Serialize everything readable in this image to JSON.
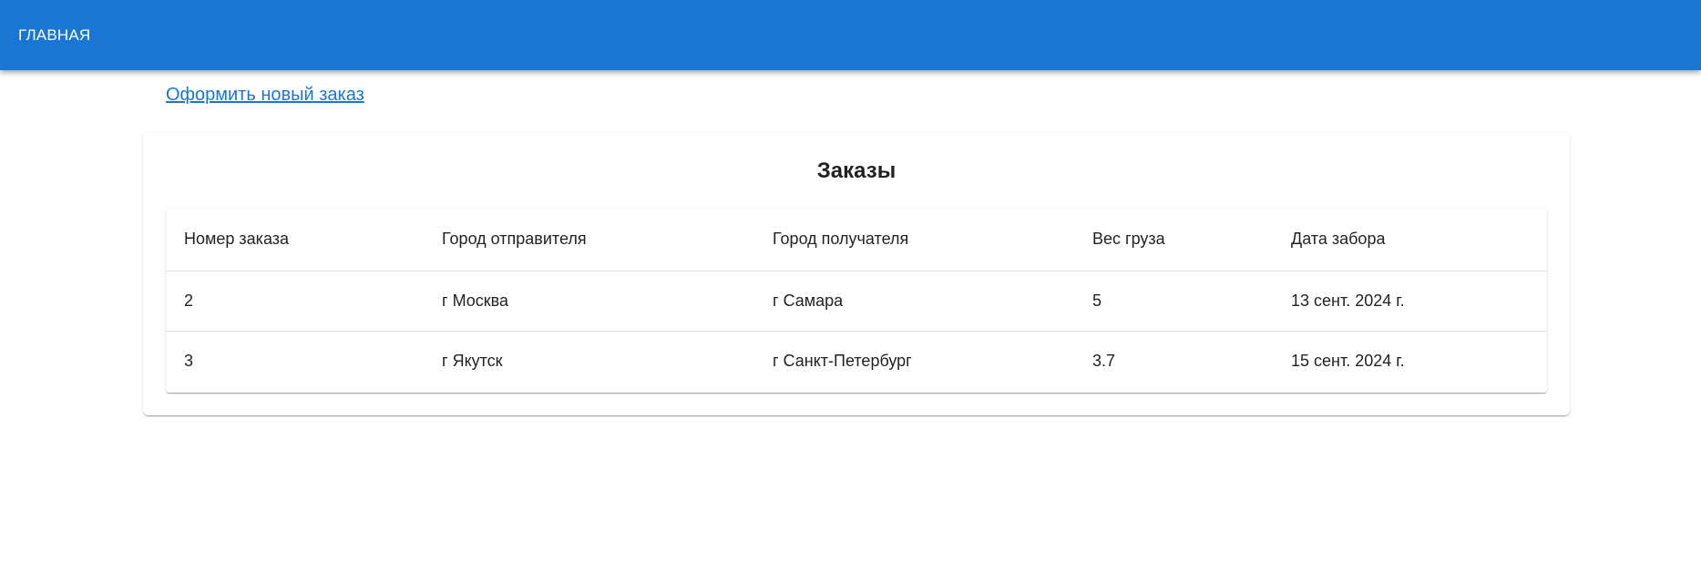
{
  "appbar": {
    "home_label": "ГЛАВНАЯ"
  },
  "actions": {
    "new_order_link": "Оформить новый заказ"
  },
  "orders": {
    "title": "Заказы",
    "columns": [
      "Номер заказа",
      "Город отправителя",
      "Город получателя",
      "Вес груза",
      "Дата забора"
    ],
    "rows": [
      [
        "2",
        "г Москва",
        "г Самара",
        "5",
        "13 сент. 2024 г."
      ],
      [
        "3",
        "г Якутск",
        "г Санкт-Петербург",
        "3.7",
        "15 сент. 2024 г."
      ]
    ]
  },
  "colors": {
    "primary": "#1976d2"
  }
}
